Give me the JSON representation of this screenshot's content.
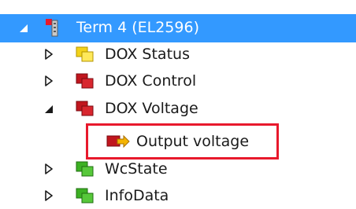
{
  "tree": {
    "root": {
      "label": "Term 4 (EL2596)",
      "icon": "terminal-icon"
    },
    "items": [
      {
        "label": "DOX Status",
        "icon": "yellow-variable-group-icon",
        "expanded": false
      },
      {
        "label": "DOX Control",
        "icon": "red-variable-group-icon",
        "expanded": false
      },
      {
        "label": "DOX Voltage",
        "icon": "red-variable-group-icon",
        "expanded": true
      },
      {
        "label": "Output voltage",
        "icon": "output-variable-icon",
        "highlighted": true
      },
      {
        "label": "WcState",
        "icon": "green-variable-group-icon",
        "expanded": false
      },
      {
        "label": "InfoData",
        "icon": "green-variable-group-icon",
        "expanded": false
      }
    ]
  },
  "colors": {
    "selection": "#3399ff",
    "highlight_border": "#e8192c",
    "yellow_group": "#f2d21a",
    "red_group": "#c0161e",
    "green_group": "#3cb023"
  }
}
